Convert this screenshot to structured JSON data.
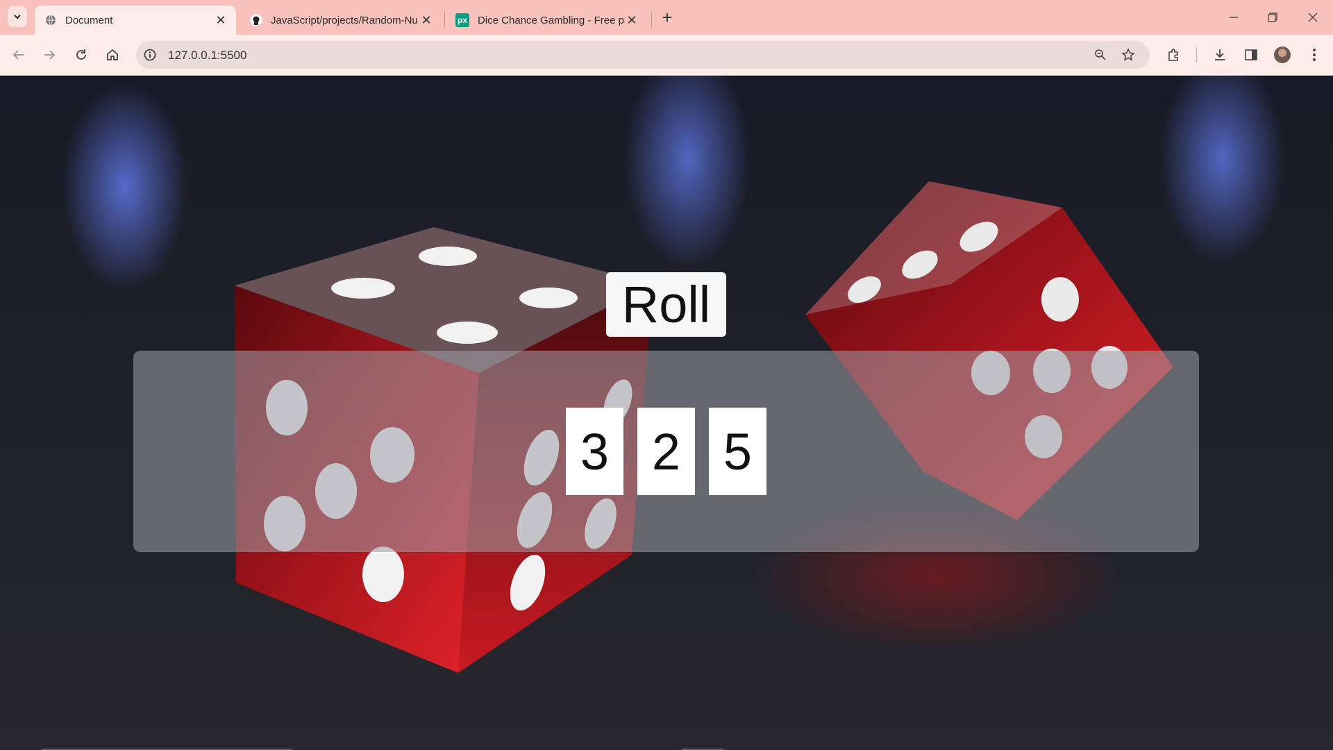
{
  "browser": {
    "tabs": [
      {
        "title": "Document",
        "active": true
      },
      {
        "title": "JavaScript/projects/Random-Nu",
        "active": false
      },
      {
        "title": "Dice Chance Gambling - Free pl",
        "active": false
      }
    ],
    "address_bar": {
      "url": "127.0.0.1:5500"
    },
    "icons": [
      "tab-search-icon",
      "globe-icon",
      "github-icon",
      "pexels-icon",
      "close-icon",
      "new-tab-icon",
      "minimize-icon",
      "restore-icon",
      "window-close-icon",
      "back-icon",
      "forward-icon",
      "reload-icon",
      "home-icon",
      "site-info-icon",
      "zoom-icon",
      "bookmark-star-icon",
      "extensions-icon",
      "downloads-icon",
      "side-panel-icon",
      "profile-avatar",
      "menu-icon"
    ],
    "pexels_badge": "px"
  },
  "page": {
    "roll_label": "Roll",
    "dice": [
      "3",
      "2",
      "5"
    ]
  },
  "colors": {
    "tabbar": "#f8c3bb",
    "toolbar": "#fdece9",
    "panel": "rgba(160,160,168,0.55)",
    "dice_art": "#b3121a"
  }
}
